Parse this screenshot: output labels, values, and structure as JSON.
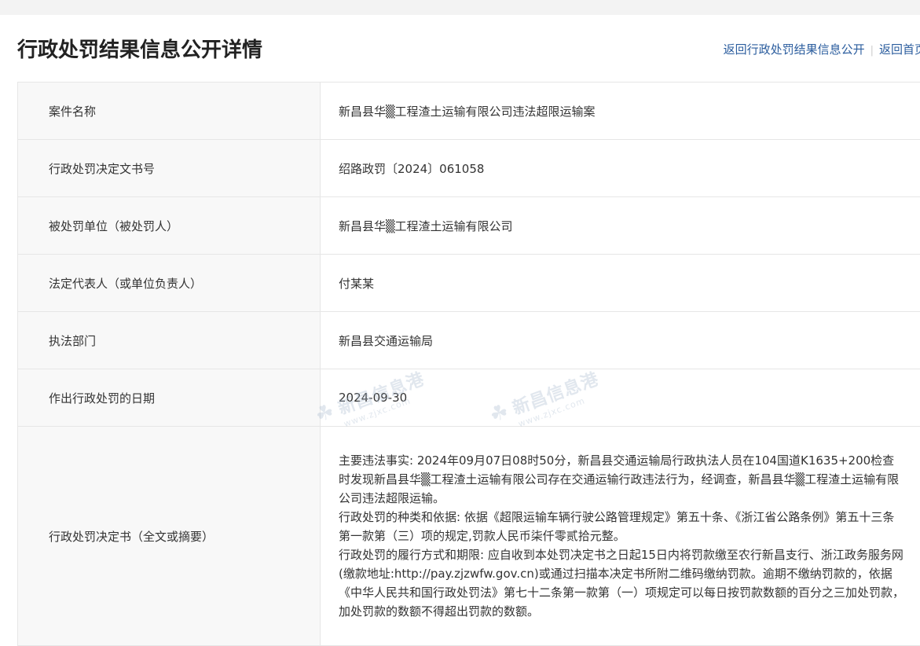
{
  "header": {
    "title": "行政处罚结果信息公开详情",
    "links": {
      "back_list": "返回行政处罚结果信息公开",
      "separator": "|",
      "back_home": "返回首页"
    }
  },
  "details": {
    "case_name": {
      "label": "案件名称",
      "value": "新昌县华▒工程渣土运输有限公司违法超限运输案"
    },
    "decision_number": {
      "label": "行政处罚决定文书号",
      "value": "绍路政罚〔2024〕061058"
    },
    "penalized_party": {
      "label": "被处罚单位（被处罚人）",
      "value": "新昌县华▒工程渣土运输有限公司"
    },
    "legal_representative": {
      "label": "法定代表人（或单位负责人）",
      "value": "付某某"
    },
    "enforcement_department": {
      "label": "执法部门",
      "value": "新昌县交通运输局"
    },
    "decision_date": {
      "label": "作出行政处罚的日期",
      "value": "2024-09-30"
    },
    "decision_document": {
      "label": "行政处罚决定书（全文或摘要）",
      "paragraphs": [
        "主要违法事实: 2024年09月07日08时50分，新昌县交通运输局行政执法人员在104国道K1635+200检查时发现新昌县华▒工程渣土运输有限公司存在交通运输行政违法行为，经调查，新昌县华▒工程渣土运输有限公司违法超限运输。",
        "行政处罚的种类和依据: 依据《超限运输车辆行驶公路管理规定》第五十条、《浙江省公路条例》第五十三条第一款第（三）项的规定,罚款人民币柒仟零贰拾元整。",
        "行政处罚的履行方式和期限: 应自收到本处罚决定书之日起15日内将罚款缴至农行新昌支行、浙江政务服务网(缴款地址:http://pay.zjzwfw.gov.cn)或通过扫描本决定书所附二维码缴纳罚款。逾期不缴纳罚款的，依据《中华人民共和国行政处罚法》第七十二条第一款第（一）项规定可以每日按罚款数额的百分之三加处罚款，加处罚款的数额不得超出罚款的数额。"
      ]
    }
  },
  "watermark": {
    "text": "新昌信息港",
    "url": "www.zjxc.com",
    "color": "#aab9cd"
  }
}
